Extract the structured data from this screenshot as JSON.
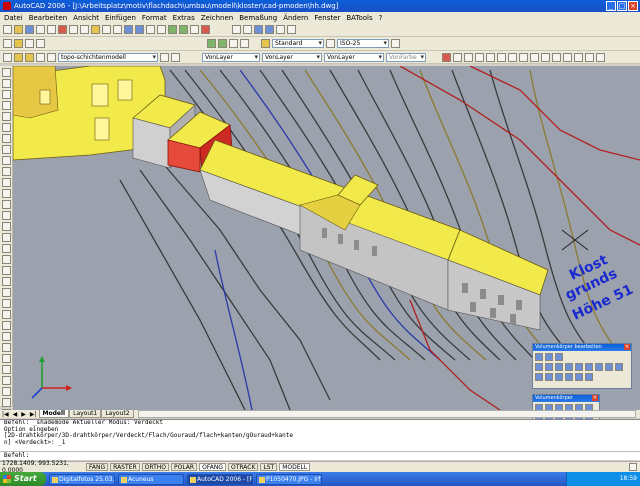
{
  "window": {
    "title": "AutoCAD 2006 - [J:\\Arbeitsplatz\\motiv\\flachdach\\umbau\\modell\\kloster\\cad-pmoden\\hh.dwg]"
  },
  "menu": [
    "Datei",
    "Bearbeiten",
    "Ansicht",
    "Einfügen",
    "Format",
    "Extras",
    "Zeichnen",
    "Bemaßung",
    "Ändern",
    "Fenster",
    "BATools",
    "?"
  ],
  "toolbar2": {
    "textstyle": "Standard",
    "dimstyle": "ISO-25"
  },
  "toolbar3": {
    "layer": "topo-schichtenmodell",
    "color": "VonLayer",
    "linetype": "VonLayer",
    "lineweight": "VonLayer",
    "plotstyle": "VonFarbe"
  },
  "tabs": [
    "Modell",
    "Layout1",
    "Layout2"
  ],
  "command_history": [
    "Befehl: _shademode Aktueller Modus: Verdeckt",
    "Option eingeben",
    "[2D-drahtkörper/3D-drahtkörper/Verdeckt/Flach/Gouraud/flach+kanten/gOuraud+kante",
    "n] <Verdeckt>: _1"
  ],
  "command_prompt": "Befehl:",
  "status": {
    "coords": "1728.1409, 993.5231, 0.0000",
    "toggles": [
      "FANG",
      "RASTER",
      "ORTHO",
      "POLAR",
      "OFANG",
      "OTRACK",
      "LST",
      "MODELL"
    ],
    "on": [
      "OFANG",
      "MODELL"
    ]
  },
  "drawing_label": [
    "Klost",
    "grunds",
    "Höhe 51"
  ],
  "palettes": {
    "edit_title": "Volumenkörper bearbeiten",
    "solids_title": "Volumenkörper"
  },
  "taskbar": {
    "start": "Start",
    "tasks": [
      "Digitalfotos 25.03.2006",
      "Acuneus",
      "AutoCAD 2006 - [F:\\p...",
      "P1050470.JPG - IrfanVi..."
    ],
    "clock": "18:59"
  },
  "colors": {
    "roof": "#f2ea4a",
    "wall": "#c8c8c8",
    "contour_dark": "#303030",
    "contour_blue": "#2a3aa8",
    "contour_red": "#b02020",
    "contour_olive": "#8a7a30"
  }
}
